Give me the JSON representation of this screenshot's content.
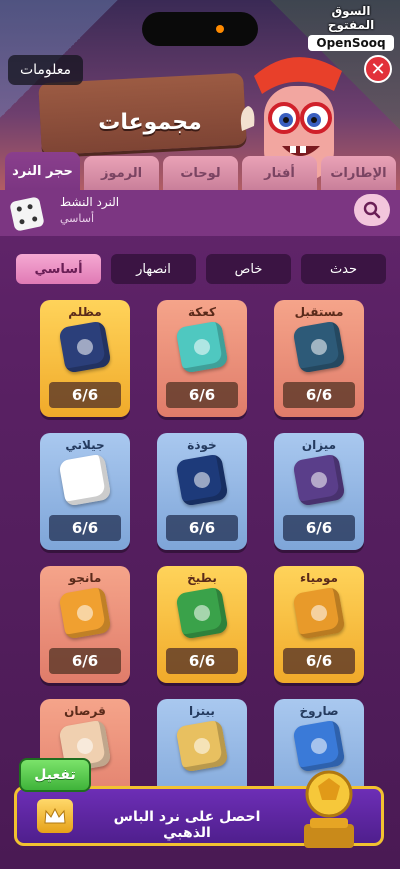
{
  "header": {
    "title": "مجموعات",
    "info_label": "معلومات",
    "close_symbol": "✕",
    "watermark_ar": "السوق المفتوح",
    "watermark_en": "OpenSooq"
  },
  "tabs": [
    {
      "label": "الإطارات"
    },
    {
      "label": "أفتار"
    },
    {
      "label": "لوحات"
    },
    {
      "label": "الرموز"
    },
    {
      "label": "حجر النرد",
      "active": true
    }
  ],
  "active_dice": {
    "title": "النرد النشط",
    "subtitle": "أساسي"
  },
  "filters": [
    {
      "label": "حدث"
    },
    {
      "label": "خاص"
    },
    {
      "label": "انصهار"
    },
    {
      "label": "أساسي",
      "active": true
    }
  ],
  "dice": [
    {
      "name": "مستقبل",
      "count": "6/6",
      "card_color": "red",
      "die_color": "#2d5a78"
    },
    {
      "name": "كعكة",
      "count": "6/6",
      "card_color": "red",
      "die_color": "#4fc8c0"
    },
    {
      "name": "مظلم",
      "count": "6/6",
      "card_color": "gold",
      "die_color": "#2b3f7a"
    },
    {
      "name": "ميزان",
      "count": "6/6",
      "card_color": "blue",
      "die_color": "#5a3e8a"
    },
    {
      "name": "خوذة",
      "count": "6/6",
      "card_color": "blue",
      "die_color": "#1d3a7a"
    },
    {
      "name": "جيلاتي",
      "count": "6/6",
      "card_color": "blue",
      "die_color": "#ffffff"
    },
    {
      "name": "مومياء",
      "count": "6/6",
      "card_color": "gold",
      "die_color": "#e89a2a"
    },
    {
      "name": "بطيخ",
      "count": "6/6",
      "card_color": "gold",
      "die_color": "#3aa24a"
    },
    {
      "name": "مانجو",
      "count": "6/6",
      "card_color": "red",
      "die_color": "#f0a030"
    },
    {
      "name": "صاروخ",
      "count": "",
      "card_color": "blue",
      "die_color": "#3a7ad8"
    },
    {
      "name": "بيتزا",
      "count": "",
      "card_color": "blue",
      "die_color": "#e8c060"
    },
    {
      "name": "قرصان",
      "count": "",
      "card_color": "red",
      "die_color": "#f0d0b0"
    }
  ],
  "bottom": {
    "activate_label": "تفعيل",
    "promo_text": "احصل على نرد الباس الذهبي"
  },
  "colors": {
    "accent_pink": "#f5a9d2",
    "panel_purple": "#7c3682",
    "close_red": "#e2313a",
    "promo_border": "#f2c230",
    "activate_green": "#3fb33a"
  }
}
